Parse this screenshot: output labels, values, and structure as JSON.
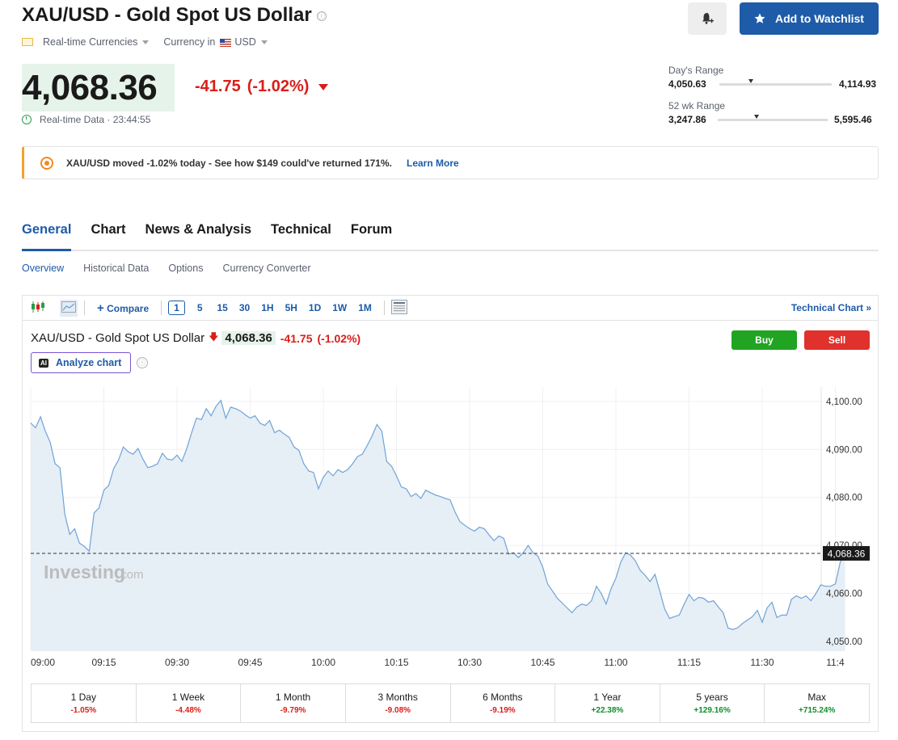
{
  "header": {
    "title": "XAU/USD - Gold Spot US Dollar",
    "info_icon": "ⓘ",
    "watchlist_label": "Add to Watchlist",
    "category_label": "Real-time Currencies",
    "currency_prefix": "Currency in",
    "currency": "USD"
  },
  "quote": {
    "price": "4,068.36",
    "change": "-41.75",
    "change_pct": "(-1.02%)",
    "data_label": "Real-time Data · 23:44:55"
  },
  "ranges": {
    "day_label": "Day's Range",
    "day_low": "4,050.63",
    "day_high": "4,114.93",
    "day_position": 0.28,
    "wk52_label": "52 wk Range",
    "wk52_low": "3,247.86",
    "wk52_high": "5,595.46",
    "wk52_position": 0.35
  },
  "banner": {
    "text": "XAU/USD moved -1.02% today - See how $149 could've returned 171%.",
    "link": "Learn More"
  },
  "tabs": [
    "General",
    "Chart",
    "News & Analysis",
    "Technical",
    "Forum"
  ],
  "subtabs": [
    "Overview",
    "Historical Data",
    "Options",
    "Currency Converter"
  ],
  "toolbar": {
    "compare_label": "Compare",
    "intervals": [
      "1",
      "5",
      "15",
      "30",
      "1H",
      "5H",
      "1D",
      "1W",
      "1M"
    ],
    "selected_interval": "1",
    "technical_chart_label": "Technical Chart »"
  },
  "chart_header": {
    "title": "XAU/USD - Gold Spot US Dollar",
    "arrow": "🡇",
    "price": "4,068.36",
    "change": "-41.75",
    "change_pct": "(-1.02%)",
    "analyze_label": "Analyze chart",
    "ai_badge": "AI",
    "buy_label": "Buy",
    "sell_label": "Sell",
    "watermark_brand": "Investing",
    "watermark_suffix": ".com"
  },
  "chart_data": {
    "type": "area",
    "x_tick_labels": [
      "09:00",
      "09:15",
      "09:30",
      "09:45",
      "10:00",
      "10:15",
      "10:30",
      "10:45",
      "11:00",
      "11:15",
      "11:30",
      "11:4"
    ],
    "y_tick_labels": [
      "4,100.00",
      "4,090.00",
      "4,080.00",
      "4,070.00",
      "4,060.00",
      "4,050.00"
    ],
    "ylim": [
      4048,
      4103
    ],
    "xlim_minutes": [
      0,
      160
    ],
    "current_price": 4068.36,
    "current_price_label": "4,068.36",
    "points": [
      [
        0,
        4095.5
      ],
      [
        1,
        4094.5
      ],
      [
        2,
        4096.8
      ],
      [
        3,
        4093.8
      ],
      [
        4,
        4091.5
      ],
      [
        5,
        4087.0
      ],
      [
        6,
        4086.2
      ],
      [
        7,
        4076.5
      ],
      [
        8,
        4072.3
      ],
      [
        9,
        4073.5
      ],
      [
        10,
        4070.5
      ],
      [
        11,
        4069.8
      ],
      [
        12,
        4068.8
      ],
      [
        13,
        4076.8
      ],
      [
        14,
        4077.8
      ],
      [
        15,
        4081.5
      ],
      [
        16,
        4082.5
      ],
      [
        17,
        4086.0
      ],
      [
        18,
        4087.8
      ],
      [
        19,
        4090.5
      ],
      [
        20,
        4089.5
      ],
      [
        21,
        4089.0
      ],
      [
        22,
        4090.2
      ],
      [
        23,
        4088.0
      ],
      [
        24,
        4086.2
      ],
      [
        25,
        4086.5
      ],
      [
        26,
        4087.0
      ],
      [
        27,
        4089.2
      ],
      [
        28,
        4088.0
      ],
      [
        29,
        4087.8
      ],
      [
        30,
        4088.8
      ],
      [
        31,
        4087.5
      ],
      [
        32,
        4090.2
      ],
      [
        33,
        4093.5
      ],
      [
        34,
        4096.5
      ],
      [
        35,
        4096.2
      ],
      [
        36,
        4098.5
      ],
      [
        37,
        4097.0
      ],
      [
        38,
        4099.0
      ],
      [
        39,
        4100.2
      ],
      [
        40,
        4096.5
      ],
      [
        41,
        4098.8
      ],
      [
        42,
        4098.5
      ],
      [
        43,
        4098.0
      ],
      [
        44,
        4097.2
      ],
      [
        45,
        4096.5
      ],
      [
        46,
        4097.0
      ],
      [
        47,
        4095.5
      ],
      [
        48,
        4095.0
      ],
      [
        49,
        4096.0
      ],
      [
        50,
        4093.5
      ],
      [
        51,
        4094.0
      ],
      [
        52,
        4093.2
      ],
      [
        53,
        4092.5
      ],
      [
        54,
        4090.5
      ],
      [
        55,
        4089.8
      ],
      [
        56,
        4087.0
      ],
      [
        57,
        4085.5
      ],
      [
        58,
        4085.2
      ],
      [
        59,
        4081.8
      ],
      [
        60,
        4084.2
      ],
      [
        61,
        4085.5
      ],
      [
        62,
        4084.5
      ],
      [
        63,
        4085.8
      ],
      [
        64,
        4085.2
      ],
      [
        65,
        4085.8
      ],
      [
        66,
        4087.0
      ],
      [
        67,
        4088.5
      ],
      [
        68,
        4089.0
      ],
      [
        69,
        4090.8
      ],
      [
        70,
        4092.8
      ],
      [
        71,
        4095.2
      ],
      [
        72,
        4093.8
      ],
      [
        73,
        4087.5
      ],
      [
        74,
        4086.5
      ],
      [
        75,
        4084.5
      ],
      [
        76,
        4082.2
      ],
      [
        77,
        4081.8
      ],
      [
        78,
        4080.2
      ],
      [
        79,
        4080.8
      ],
      [
        80,
        4079.8
      ],
      [
        81,
        4081.5
      ],
      [
        82,
        4081.0
      ],
      [
        83,
        4080.5
      ],
      [
        84,
        4080.2
      ],
      [
        85,
        4079.8
      ],
      [
        86,
        4079.5
      ],
      [
        87,
        4077.0
      ],
      [
        88,
        4075.0
      ],
      [
        89,
        4074.2
      ],
      [
        90,
        4073.5
      ],
      [
        91,
        4073.0
      ],
      [
        92,
        4073.8
      ],
      [
        93,
        4073.5
      ],
      [
        94,
        4072.2
      ],
      [
        95,
        4071.0
      ],
      [
        96,
        4072.0
      ],
      [
        97,
        4071.5
      ],
      [
        98,
        4068.2
      ],
      [
        99,
        4068.5
      ],
      [
        100,
        4067.5
      ],
      [
        101,
        4068.5
      ],
      [
        102,
        4070.0
      ],
      [
        103,
        4068.5
      ],
      [
        104,
        4067.8
      ],
      [
        105,
        4065.5
      ],
      [
        106,
        4062.0
      ],
      [
        107,
        4060.5
      ],
      [
        108,
        4059.0
      ],
      [
        109,
        4058.0
      ],
      [
        110,
        4057.0
      ],
      [
        111,
        4056.0
      ],
      [
        112,
        4057.2
      ],
      [
        113,
        4057.8
      ],
      [
        114,
        4057.5
      ],
      [
        115,
        4058.5
      ],
      [
        116,
        4061.5
      ],
      [
        117,
        4060.0
      ],
      [
        118,
        4057.8
      ],
      [
        119,
        4061.0
      ],
      [
        120,
        4063.2
      ],
      [
        121,
        4066.5
      ],
      [
        122,
        4068.5
      ],
      [
        123,
        4068.0
      ],
      [
        124,
        4066.8
      ],
      [
        125,
        4064.8
      ],
      [
        126,
        4063.8
      ],
      [
        127,
        4062.5
      ],
      [
        128,
        4064.0
      ],
      [
        129,
        4060.5
      ],
      [
        130,
        4056.8
      ],
      [
        131,
        4054.8
      ],
      [
        132,
        4055.2
      ],
      [
        133,
        4055.5
      ],
      [
        134,
        4057.8
      ],
      [
        135,
        4059.8
      ],
      [
        136,
        4058.5
      ],
      [
        137,
        4059.2
      ],
      [
        138,
        4059.0
      ],
      [
        139,
        4058.2
      ],
      [
        140,
        4058.5
      ],
      [
        141,
        4057.2
      ],
      [
        142,
        4056.0
      ],
      [
        143,
        4052.8
      ],
      [
        144,
        4052.5
      ],
      [
        145,
        4052.9
      ],
      [
        146,
        4053.8
      ],
      [
        147,
        4054.5
      ],
      [
        148,
        4055.2
      ],
      [
        149,
        4056.5
      ],
      [
        150,
        4054.0
      ],
      [
        151,
        4057.0
      ],
      [
        152,
        4058.2
      ],
      [
        153,
        4055.0
      ],
      [
        154,
        4055.5
      ],
      [
        155,
        4055.5
      ],
      [
        156,
        4058.8
      ],
      [
        157,
        4059.5
      ],
      [
        158,
        4059.0
      ],
      [
        159,
        4059.5
      ],
      [
        160,
        4058.5
      ],
      [
        161,
        4060.0
      ],
      [
        162,
        4061.8
      ],
      [
        163,
        4061.5
      ],
      [
        164,
        4061.5
      ],
      [
        165,
        4062.0
      ],
      [
        166,
        4066.5
      ],
      [
        167,
        4068.4
      ]
    ]
  },
  "performance": [
    {
      "label": "1 Day",
      "value": "-1.05%",
      "dir": "neg"
    },
    {
      "label": "1 Week",
      "value": "-4.48%",
      "dir": "neg"
    },
    {
      "label": "1 Month",
      "value": "-9.79%",
      "dir": "neg"
    },
    {
      "label": "3 Months",
      "value": "-9.08%",
      "dir": "neg"
    },
    {
      "label": "6 Months",
      "value": "-9.19%",
      "dir": "neg"
    },
    {
      "label": "1 Year",
      "value": "+22.38%",
      "dir": "pos"
    },
    {
      "label": "5 years",
      "value": "+129.16%",
      "dir": "pos"
    },
    {
      "label": "Max",
      "value": "+715.24%",
      "dir": "pos"
    }
  ],
  "colors": {
    "brand_blue": "#1e5ba8",
    "negative": "#d91e18",
    "positive": "#128c2a",
    "price_highlight": "#e6f3ea",
    "chart_line": "#6fa3d6",
    "chart_fill": "#e3ecf5"
  }
}
